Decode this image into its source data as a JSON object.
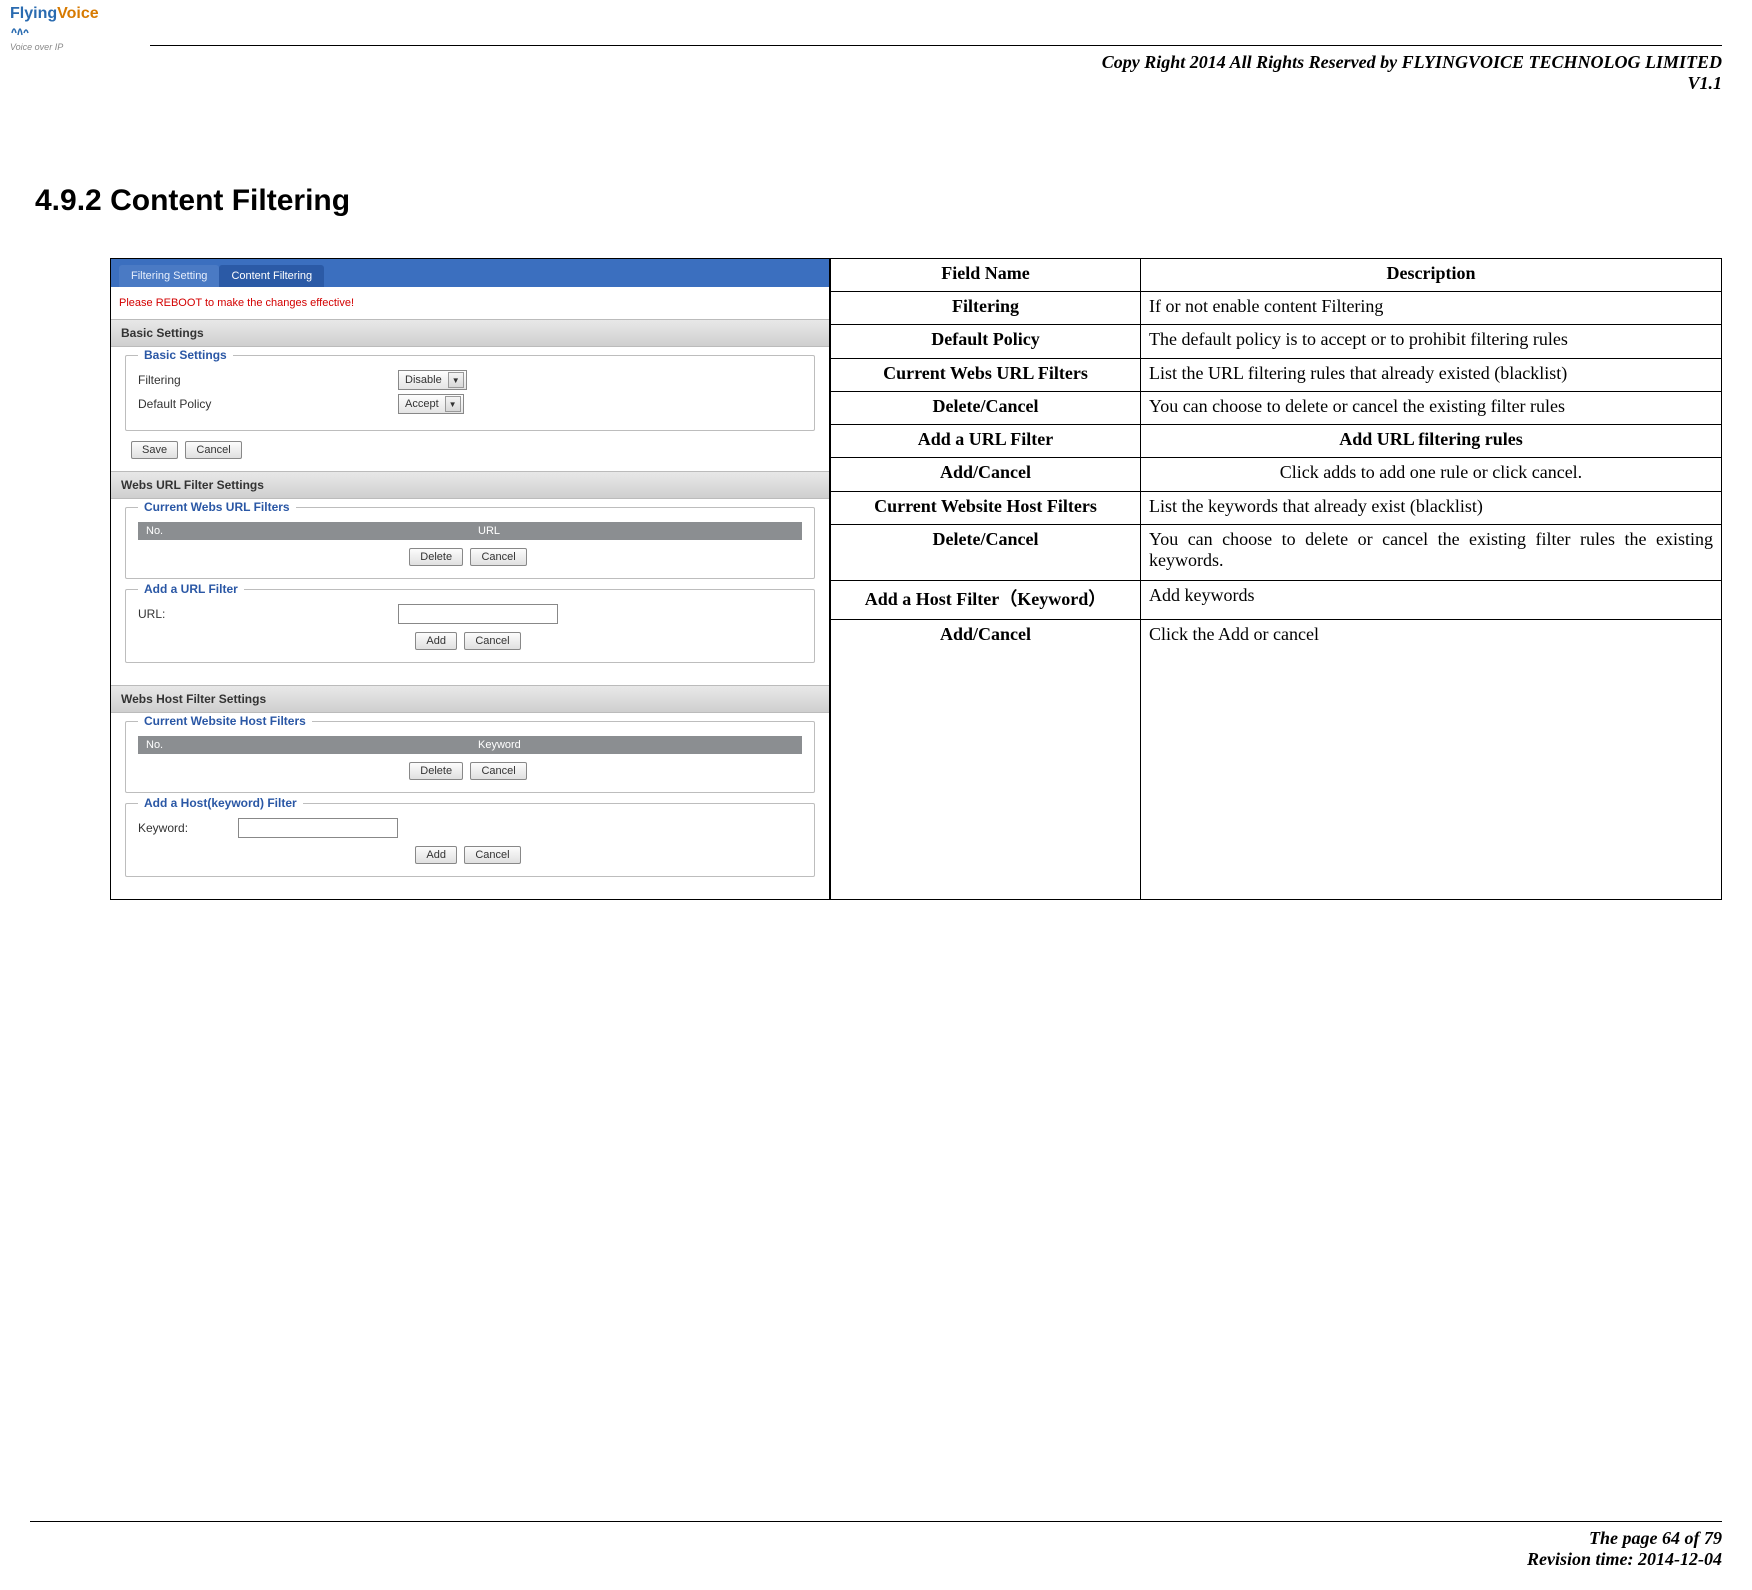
{
  "header": {
    "copyright": "Copy Right 2014 All Rights Reserved by FLYINGVOICE TECHNOLOG LIMITED",
    "version": "V1.1"
  },
  "logo": {
    "brand_part1": "Flying",
    "brand_part2": "Voice",
    "tagline": "Voice over IP"
  },
  "section": {
    "number": "4.9.2",
    "title": "Content Filtering"
  },
  "screenshot": {
    "tabs": {
      "inactive": "Filtering Setting",
      "active": "Content Filtering"
    },
    "reboot_notice": "Please REBOOT to make the changes effective!",
    "panels": {
      "basic": {
        "title": "Basic Settings",
        "legend": "Basic Settings",
        "rows": {
          "filtering": {
            "label": "Filtering",
            "value": "Disable"
          },
          "default_policy": {
            "label": "Default Policy",
            "value": "Accept"
          }
        },
        "buttons": {
          "save": "Save",
          "cancel": "Cancel"
        }
      },
      "url_filter": {
        "title": "Webs URL Filter Settings",
        "current": {
          "legend": "Current Webs URL Filters",
          "col_no": "No.",
          "col_url": "URL",
          "buttons": {
            "delete": "Delete",
            "cancel": "Cancel"
          }
        },
        "add": {
          "legend": "Add a URL Filter",
          "label": "URL:",
          "buttons": {
            "add": "Add",
            "cancel": "Cancel"
          }
        }
      },
      "host_filter": {
        "title": "Webs Host Filter Settings",
        "current": {
          "legend": "Current Website Host Filters",
          "col_no": "No.",
          "col_kw": "Keyword",
          "buttons": {
            "delete": "Delete",
            "cancel": "Cancel"
          }
        },
        "add": {
          "legend": "Add a Host(keyword) Filter",
          "label": "Keyword:",
          "buttons": {
            "add": "Add",
            "cancel": "Cancel"
          }
        }
      }
    }
  },
  "table": {
    "head": {
      "field": "Field Name",
      "desc": "Description"
    },
    "rows": [
      {
        "field": "Filtering",
        "desc": "If or not enable content Filtering"
      },
      {
        "field": "Default Policy",
        "desc": "The default policy is to accept or to prohibit filtering rules"
      },
      {
        "field": "Current Webs URL Filters",
        "desc": "List the URL filtering rules that already existed (blacklist)"
      },
      {
        "field": "Delete/Cancel",
        "desc": "You can choose to delete or cancel the existing filter rules"
      },
      {
        "field": "Add a URL Filter",
        "desc": "Add URL filtering rules",
        "desc_bold_center": true
      },
      {
        "field": "Add/Cancel",
        "desc": "Click adds to add one rule or click cancel.",
        "desc_center": true
      },
      {
        "field": "Current Website Host Filters",
        "desc": "List the keywords that already exist (blacklist)"
      },
      {
        "field": "Delete/Cancel",
        "desc": "You can choose to delete or cancel the existing filter rules the existing keywords."
      },
      {
        "field": "Add a Host Filter（Keyword）",
        "desc": "Add keywords"
      },
      {
        "field": "Add/Cancel",
        "desc": "Click the Add or cancel",
        "tall": true
      }
    ]
  },
  "footer": {
    "page": "The page 64 of 79",
    "revision": "Revision time: 2014-12-04"
  }
}
